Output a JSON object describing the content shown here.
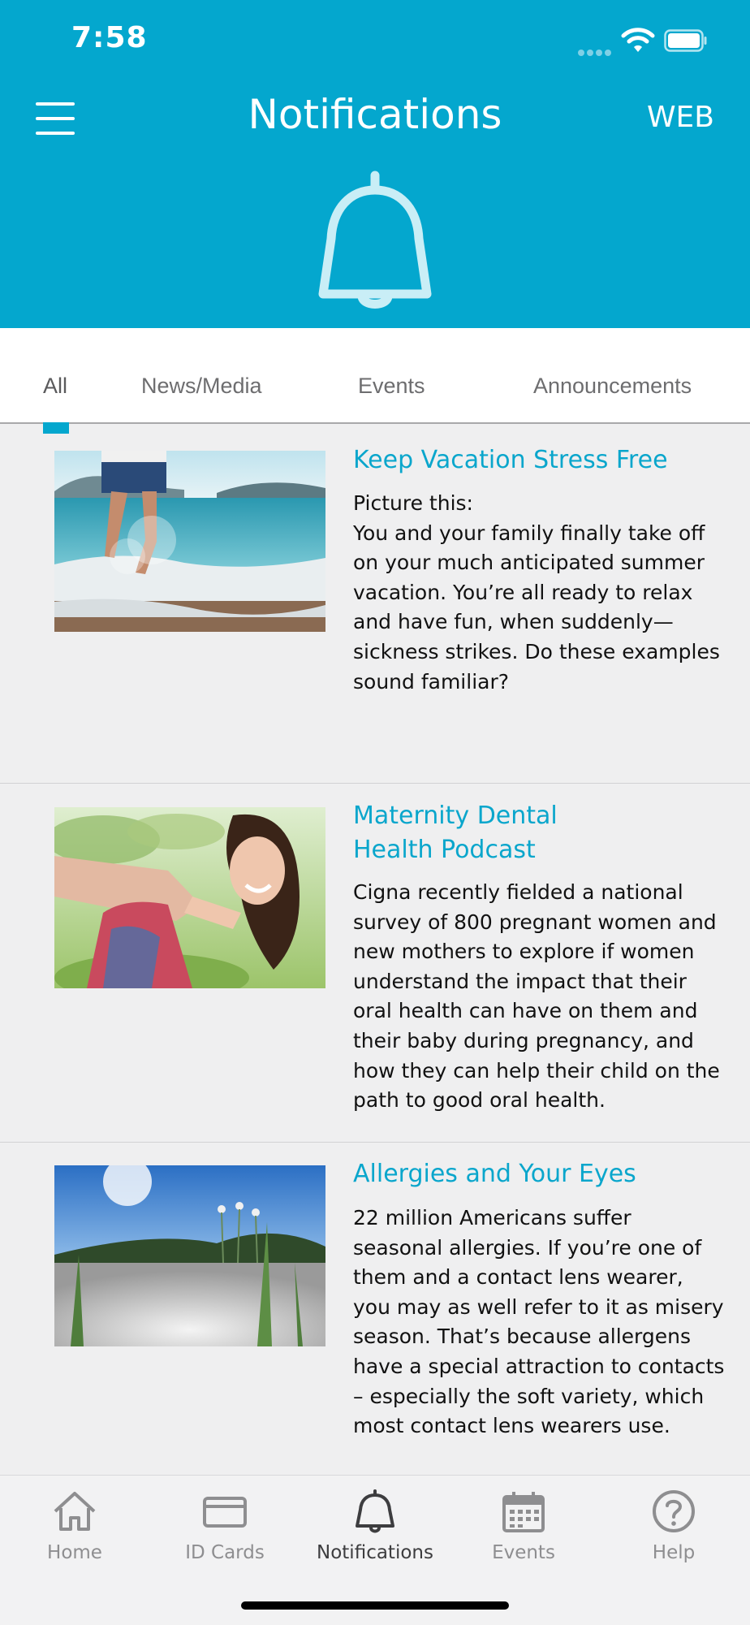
{
  "status": {
    "time": "7:58"
  },
  "header": {
    "title": "Notifications",
    "web_label": "WEB"
  },
  "colors": {
    "brand": "#04a7ce",
    "title_accent": "#0aa6cc"
  },
  "tabs": [
    {
      "label": "All",
      "active": true
    },
    {
      "label": "News/Media",
      "active": false
    },
    {
      "label": "Events",
      "active": false
    },
    {
      "label": "Announcements",
      "active": false
    }
  ],
  "articles": [
    {
      "title": "Keep Vacation Stress Free",
      "body": "Picture this:\nYou and your family finally take off on your much anticipated summer vacation. You’re all ready to relax and have fun, when suddenly—sickness strikes. Do these examples sound familiar?",
      "image_icon": "beach-splash-photo"
    },
    {
      "title": "Maternity Dental\nHealth Podcast",
      "body": "Cigna recently fielded a national survey of 800 pregnant women and new mothers to explore if women understand the impact that their oral health can have on them and their baby during pregnancy, and how they can help their child on the path to good oral health.",
      "image_icon": "smiling-woman-photo"
    },
    {
      "title": "Allergies and Your Eyes",
      "body": "22 million Americans suffer seasonal allergies. If you’re one of them and a contact lens wearer, you may as well refer to it as misery season. That’s because allergens have a special attraction to contacts – especially the soft variety, which most contact lens wearers use.",
      "image_icon": "dandelion-field-photo"
    }
  ],
  "tabbar": {
    "items": [
      {
        "label": "Home",
        "icon": "home-icon"
      },
      {
        "label": "ID Cards",
        "icon": "id-card-icon"
      },
      {
        "label": "Notifications",
        "icon": "bell-icon"
      },
      {
        "label": "Events",
        "icon": "calendar-icon"
      },
      {
        "label": "Help",
        "icon": "help-icon"
      }
    ],
    "active_index": 2
  }
}
